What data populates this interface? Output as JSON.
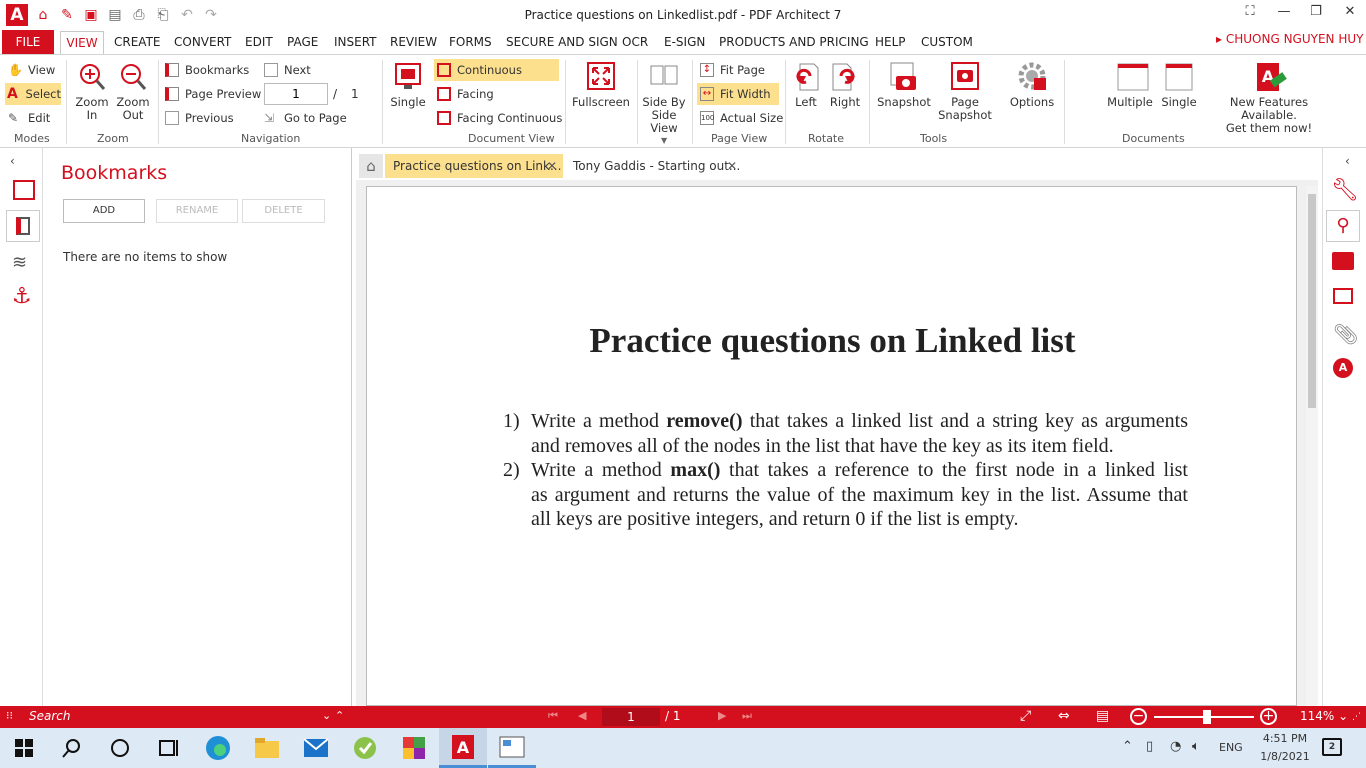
{
  "window": {
    "title": "Practice questions on Linkedlist.pdf   -   PDF Architect 7"
  },
  "menu": {
    "file": "FILE",
    "tabs": [
      "VIEW",
      "CREATE",
      "CONVERT",
      "EDIT",
      "PAGE",
      "INSERT",
      "REVIEW",
      "FORMS",
      "SECURE AND SIGN",
      "OCR",
      "E-SIGN",
      "PRODUCTS AND PRICING",
      "HELP",
      "CUSTOM"
    ],
    "user": "CHUONG NGUYEN HUY"
  },
  "ribbon": {
    "modes": {
      "view": "View",
      "select": "Select",
      "edit": "Edit",
      "group": "Modes"
    },
    "zoom": {
      "in1": "Zoom",
      "in2": "In",
      "out1": "Zoom",
      "out2": "Out",
      "group": "Zoom"
    },
    "navigation": {
      "bookmarks": "Bookmarks",
      "page_preview": "Page Preview",
      "previous": "Previous",
      "next": "Next",
      "page_input": "1",
      "page_sep": "/",
      "page_total": "1",
      "goto": "Go to Page",
      "group": "Navigation"
    },
    "docview": {
      "single": "Single",
      "continuous": "Continuous",
      "facing": "Facing",
      "facing_continuous": "Facing Continuous",
      "group": "Document View"
    },
    "fullscreen": "Fullscreen",
    "sidebyside": {
      "l1": "Side By",
      "l2": "Side",
      "l3": "View"
    },
    "pageview": {
      "fit_page": "Fit Page",
      "fit_width": "Fit Width",
      "actual_size": "Actual Size",
      "group": "Page View"
    },
    "rotate": {
      "left": "Left",
      "right": "Right",
      "group": "Rotate"
    },
    "tools": {
      "snapshot": "Snapshot",
      "page_snapshot1": "Page",
      "page_snapshot2": "Snapshot",
      "options": "Options",
      "group": "Tools"
    },
    "documents": {
      "multiple": "Multiple",
      "single": "Single",
      "new1": "New Features Available.",
      "new2": "Get them now!",
      "group": "Documents"
    }
  },
  "bookmarks": {
    "title": "Bookmarks",
    "add": "ADD",
    "rename": "RENAME",
    "delete": "DELETE",
    "empty": "There are no items to show"
  },
  "doctabs": [
    {
      "label": "Practice questions on Link...",
      "active": true
    },
    {
      "label": "Tony Gaddis - Starting out...",
      "active": false
    }
  ],
  "pdf": {
    "heading": "Practice questions on Linked list",
    "items": [
      {
        "num": "1)",
        "pre": "Write a method ",
        "bold": "remove()",
        "post": " that takes a linked list and a string key as arguments",
        "line2": "and removes all of the nodes in the list that have the key as its item field."
      },
      {
        "num": "2)",
        "pre": "Write a method ",
        "bold": "max()",
        "post": " that takes a reference to the first node in a linked list",
        "line2": "as argument and returns the value of the maximum key in the list. Assume that",
        "line3": "all keys are positive integers, and return 0 if the list is empty."
      }
    ]
  },
  "status": {
    "search": "Search",
    "page_current": "1",
    "page_total": "/ 1",
    "zoom": "114%"
  },
  "taskbar": {
    "time": "4:51 PM",
    "date": "1/8/2021",
    "lang": "ENG"
  },
  "colors": {
    "accent": "#d4101f",
    "highlight": "#fde08e"
  }
}
